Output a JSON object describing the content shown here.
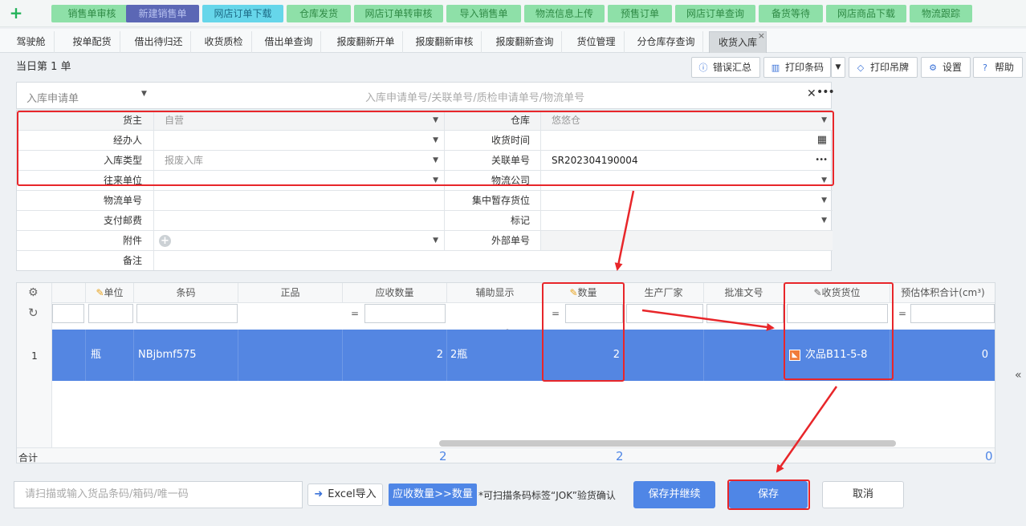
{
  "top_nav": {
    "items": [
      {
        "label": "销售单审核",
        "active": false
      },
      {
        "label": "新建销售单",
        "active": true
      },
      {
        "label": "网店订单下载",
        "active": false,
        "highlight": true
      },
      {
        "label": "仓库发货",
        "active": false
      },
      {
        "label": "网店订单转审核",
        "active": false
      },
      {
        "label": "导入销售单",
        "active": false
      },
      {
        "label": "物流信息上传",
        "active": false
      },
      {
        "label": "预售订单",
        "active": false
      },
      {
        "label": "网店订单查询",
        "active": false
      },
      {
        "label": "备货等待",
        "active": false
      },
      {
        "label": "网店商品下载",
        "active": false
      },
      {
        "label": "物流跟踪",
        "active": false
      }
    ]
  },
  "tabs": {
    "items": [
      "驾驶舱",
      "按单配货",
      "借出待归还",
      "收货质检",
      "借出单查询",
      "报废翻新开单",
      "报废翻新审核",
      "报废翻新查询",
      "货位管理",
      "分仓库存查询",
      "收货入库"
    ],
    "active_index": 10
  },
  "header": {
    "day_label": "当日第 1 单"
  },
  "toolbar": {
    "error_summary": "错误汇总",
    "print_barcode": "打印条码",
    "print_tag": "打印吊牌",
    "settings": "设置",
    "help": "帮助"
  },
  "request": {
    "type_label": "入库申请单",
    "search_placeholder": "入库申请单号/关联单号/质检申请单号/物流单号"
  },
  "form": {
    "owner_label": "货主",
    "owner_value": "自营",
    "warehouse_label": "仓库",
    "warehouse_value": "悠悠仓",
    "handler_label": "经办人",
    "handler_value": "",
    "receive_time_label": "收货时间",
    "receive_time_value": "",
    "inbound_type_label": "入库类型",
    "inbound_type_value": "报废入库",
    "related_no_label": "关联单号",
    "related_no_value": "SR202304190004",
    "partner_label": "往来单位",
    "partner_value": "",
    "logistics_co_label": "物流公司",
    "logistics_co_value": "",
    "tracking_no_label": "物流单号",
    "tracking_no_value": "",
    "staging_label": "集中暂存货位",
    "staging_value": "",
    "postage_label": "支付邮费",
    "postage_value": "",
    "mark_label": "标记",
    "mark_value": "",
    "attachment_label": "附件",
    "external_no_label": "外部单号",
    "external_no_value": "",
    "remark_label": "备注",
    "remark_value": ""
  },
  "grid": {
    "columns": [
      "单位",
      "条码",
      "正品",
      "应收数量",
      "辅助显示",
      "数量",
      "生产厂家",
      "批准文号",
      "收货货位",
      "预估体积合计(cm³)"
    ],
    "filter_eq": "=",
    "row": {
      "index": "1",
      "unit": "瓶",
      "barcode": "NBjbmf575",
      "genuine": "",
      "expected_qty": "2",
      "aux": "2瓶",
      "qty": "2",
      "maker": "",
      "approval": "",
      "location": "次品B11-5-8",
      "volume": "0"
    },
    "footer": {
      "label": "合计",
      "expected_total": "2",
      "qty_total": "2",
      "volume_total": "0"
    }
  },
  "bottom": {
    "scan_placeholder": "请扫描或输入货品条码/箱码/唯一码",
    "excel_import": "Excel导入",
    "copy_qty": "应收数量>>数量",
    "hint": "*可扫描条码标签“JOK”验货确认",
    "save_continue": "保存并继续",
    "save": "保存",
    "cancel": "取消"
  },
  "colors": {
    "accent": "#4f86e6",
    "selected_row": "#5486e2",
    "nav_green": "#8ee0a8",
    "nav_active": "#5b67b5",
    "nav_highlight": "#66d6ea",
    "annotation_red": "#e8262a"
  }
}
